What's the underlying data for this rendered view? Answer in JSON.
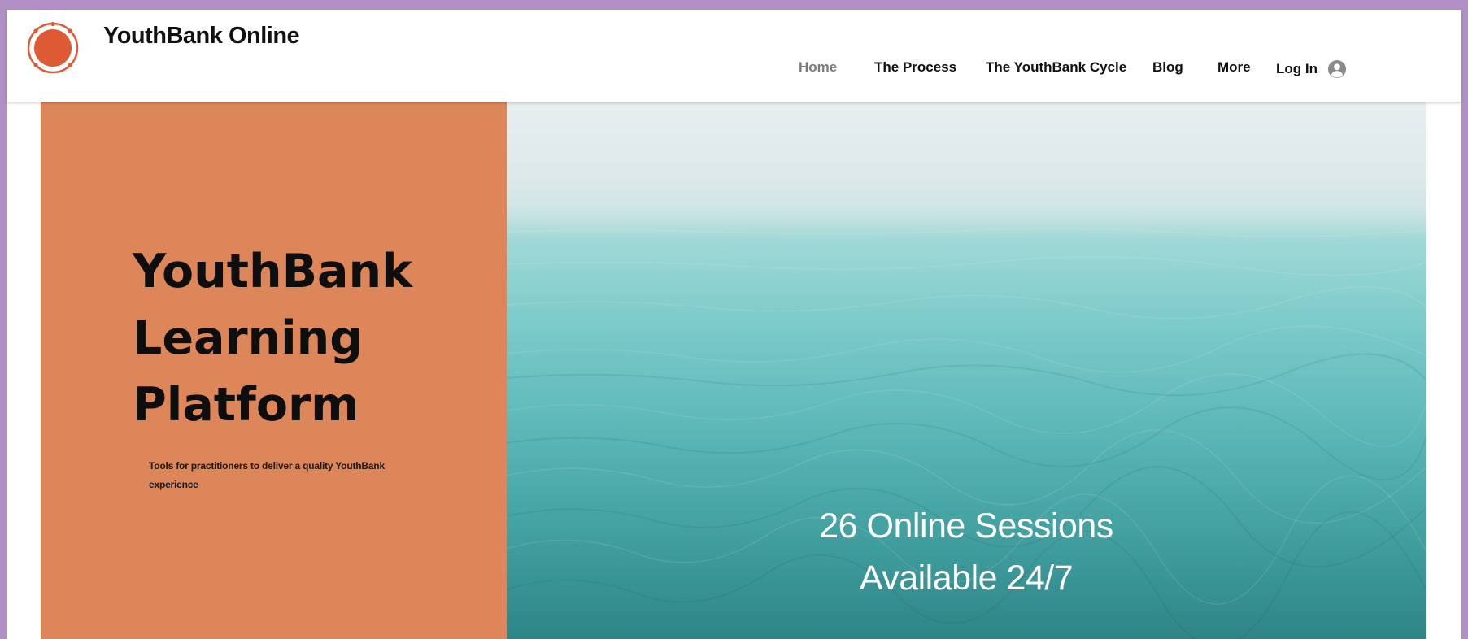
{
  "site": {
    "title": "YouthBank Online"
  },
  "nav": {
    "items": [
      {
        "label": "Home",
        "active": true
      },
      {
        "label": "The Process"
      },
      {
        "label": "The YouthBank Cycle"
      },
      {
        "label": "Blog"
      },
      {
        "label": "More"
      }
    ],
    "login_label": "Log In"
  },
  "hero": {
    "title_lines": [
      "YouthBank",
      "Learning",
      "Platform"
    ],
    "subtitle": "Tools for practitioners to deliver a quality YouthBank experience",
    "sessions_line1": "26 Online Sessions",
    "sessions_line2": "Available 24/7"
  },
  "colors": {
    "frame_border": "#b18fc4",
    "panel_orange": "#dc8659",
    "logo_red": "#de5a35",
    "sea_teal": "#4fadad"
  },
  "icons": {
    "logo": "circle-logo-icon",
    "avatar": "user-avatar-icon"
  }
}
